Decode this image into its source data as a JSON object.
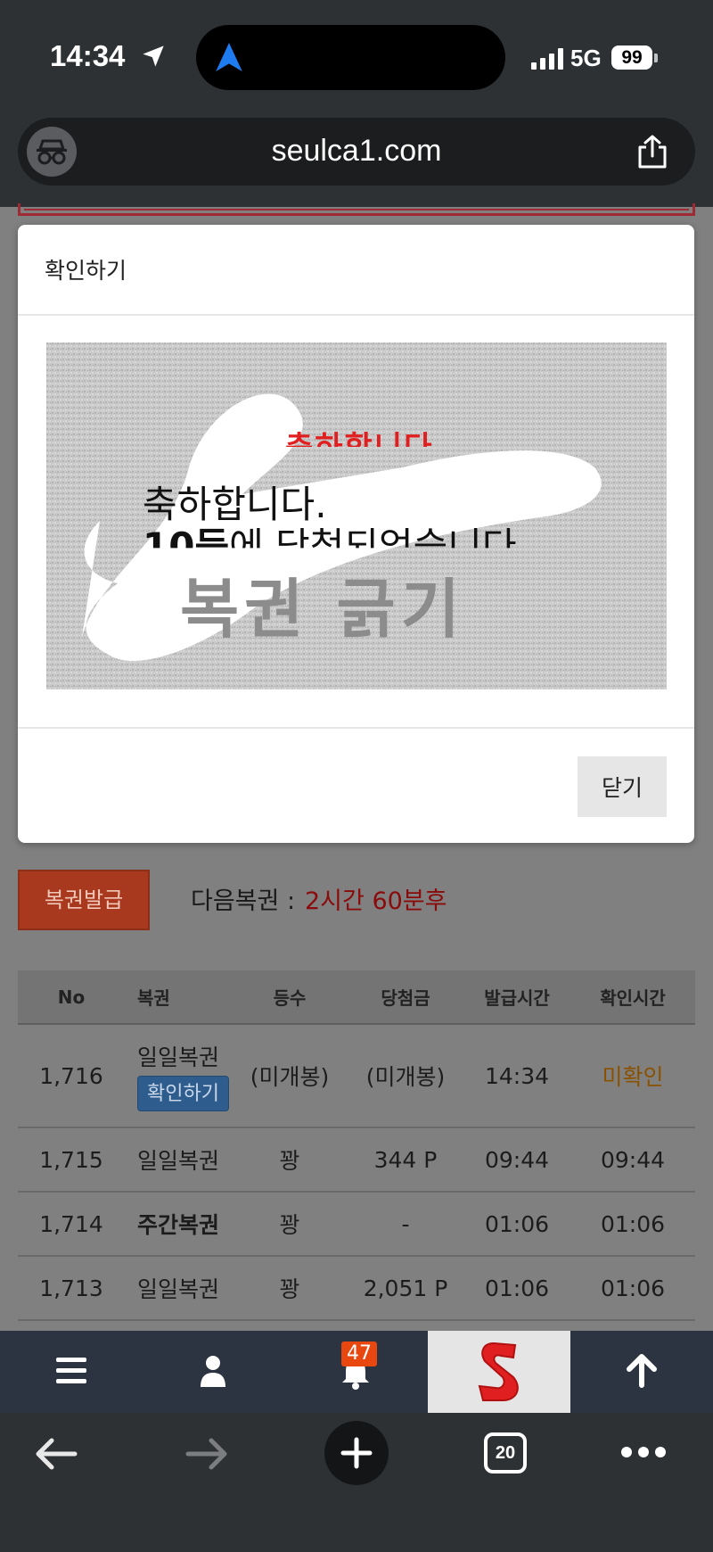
{
  "status_bar": {
    "time": "14:34",
    "network": "5G",
    "battery": "99"
  },
  "browser": {
    "url": "seulca1.com",
    "tab_count": "20"
  },
  "modal": {
    "title": "확인하기",
    "scratch_text_line1": "축하합니다.",
    "scratch_rank": "10등",
    "scratch_text_line2": "에 당첨되었습니다",
    "scratch_banner": "축하합니다",
    "scratch_watermark": "복권 긁기",
    "close_label": "닫기"
  },
  "lottery": {
    "issue_button": "복권발급",
    "next_label": "다음복권 :",
    "next_value": "2시간 60분후",
    "columns": [
      "No",
      "복권",
      "등수",
      "당첨금",
      "발급시간",
      "확인시간"
    ],
    "rows": [
      {
        "no": "1,716",
        "ticket": "일일복권",
        "badge": "확인하기",
        "rank": "(미개봉)",
        "prize": "(미개봉)",
        "issued": "14:34",
        "checked": "미확인"
      },
      {
        "no": "1,715",
        "ticket": "일일복권",
        "rank": "꽝",
        "prize": "344 P",
        "issued": "09:44",
        "checked": "09:44"
      },
      {
        "no": "1,714",
        "ticket": "주간복권",
        "rank": "꽝",
        "prize": "-",
        "issued": "01:06",
        "checked": "01:06"
      },
      {
        "no": "1,713",
        "ticket": "일일복권",
        "rank": "꽝",
        "prize": "2,051 P",
        "issued": "01:06",
        "checked": "01:06"
      }
    ]
  },
  "site_nav": {
    "notification_count": "47"
  },
  "colors": {
    "accent_red": "#a8391f",
    "next_value": "#8a0b0b",
    "unconfirmed": "#8a5200",
    "badge_blue": "#2e5c8c",
    "nav_bg": "#2b3440"
  }
}
